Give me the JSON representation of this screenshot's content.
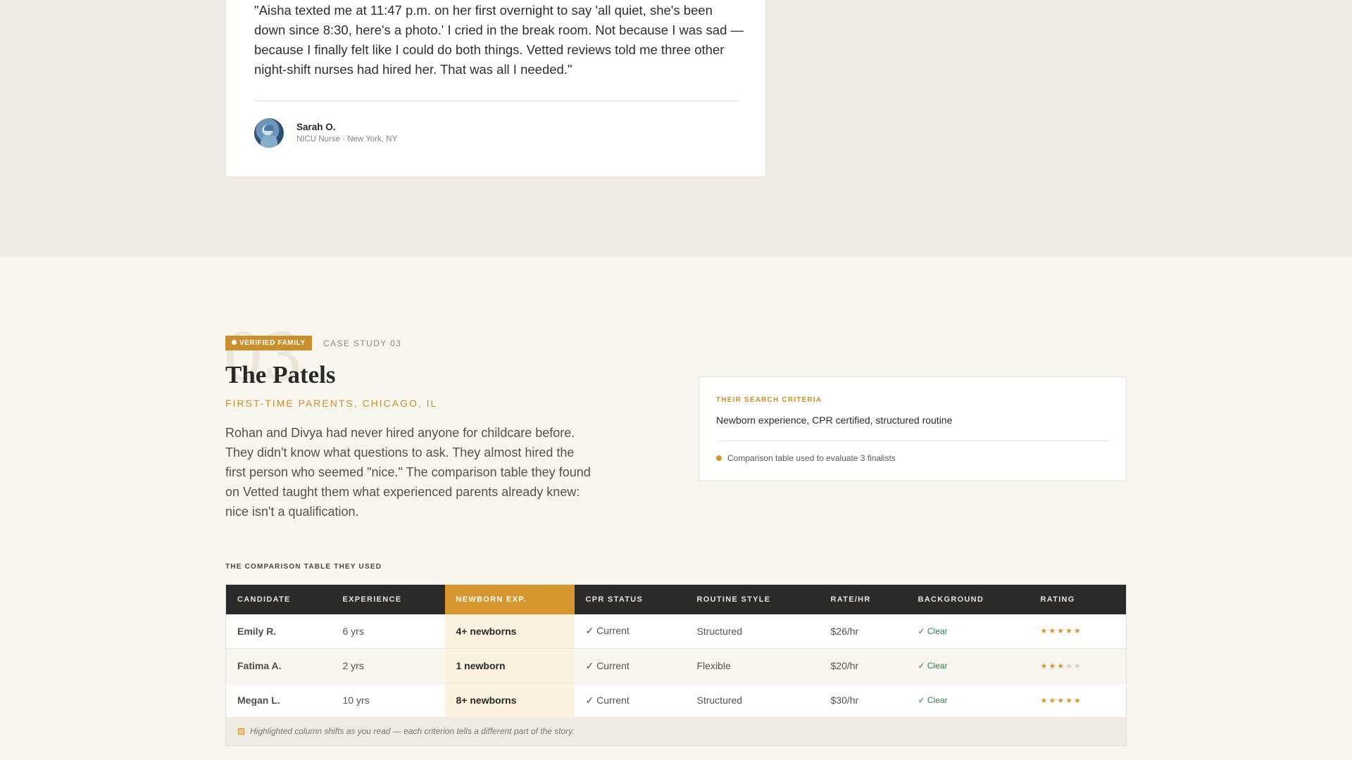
{
  "testimonial": {
    "quote": "\"Aisha texted me at 11:47 p.m. on her first overnight to say 'all quiet, she's been down since 8:30, here's a photo.' I cried in the break room. Not because I was sad — because I finally felt like I could do both things. Vetted reviews told me three other night-shift nurses had hired her. That was all I needed.\"",
    "author_name": "Sarah O.",
    "author_meta": "NICU Nurse · New York, NY"
  },
  "case_study": {
    "badge": "VERIFIED FAMILY",
    "label": "CASE STUDY 03",
    "number": "03",
    "title": "The Patels",
    "subtitle": "FIRST-TIME PARENTS, CHICAGO, IL",
    "story": "Rohan and Divya had never hired anyone for childcare before. They didn't know what questions to ask. They almost hired the first person who seemed \"nice.\" The comparison table they found on Vetted taught them what experienced parents already knew: nice isn't a qualification."
  },
  "criteria": {
    "label": "THEIR SEARCH CRITERIA",
    "value": "Newborn experience, CPR certified, structured routine",
    "note": "Comparison table used to evaluate 3 finalists"
  },
  "comparison": {
    "caption": "THE COMPARISON TABLE THEY USED",
    "headers": [
      "CANDIDATE",
      "EXPERIENCE",
      "NEWBORN EXP.",
      "CPR STATUS",
      "ROUTINE STYLE",
      "RATE/HR",
      "BACKGROUND",
      "RATING"
    ],
    "rows": [
      {
        "candidate": "Emily R.",
        "experience": "6 yrs",
        "newborn": "4+ newborns",
        "cpr": "✓ Current",
        "routine": "Structured",
        "rate": "$26/hr",
        "background": "✓ Clear",
        "rating": 5
      },
      {
        "candidate": "Fatima A.",
        "experience": "2 yrs",
        "newborn": "1 newborn",
        "cpr": "✓ Current",
        "routine": "Flexible",
        "rate": "$20/hr",
        "background": "✓ Clear",
        "rating": 3
      },
      {
        "candidate": "Megan L.",
        "experience": "10 yrs",
        "newborn": "8+ newborns",
        "cpr": "✓ Current",
        "routine": "Structured",
        "rate": "$30/hr",
        "background": "✓ Clear",
        "rating": 5
      }
    ],
    "rating_max": 5,
    "footnote": "Highlighted column shifts as you read — each criterion tells a different part of the story."
  },
  "colors": {
    "accent": "#d4962d",
    "header_dark": "#2c2b29",
    "clear_green": "#2e7d4a"
  }
}
